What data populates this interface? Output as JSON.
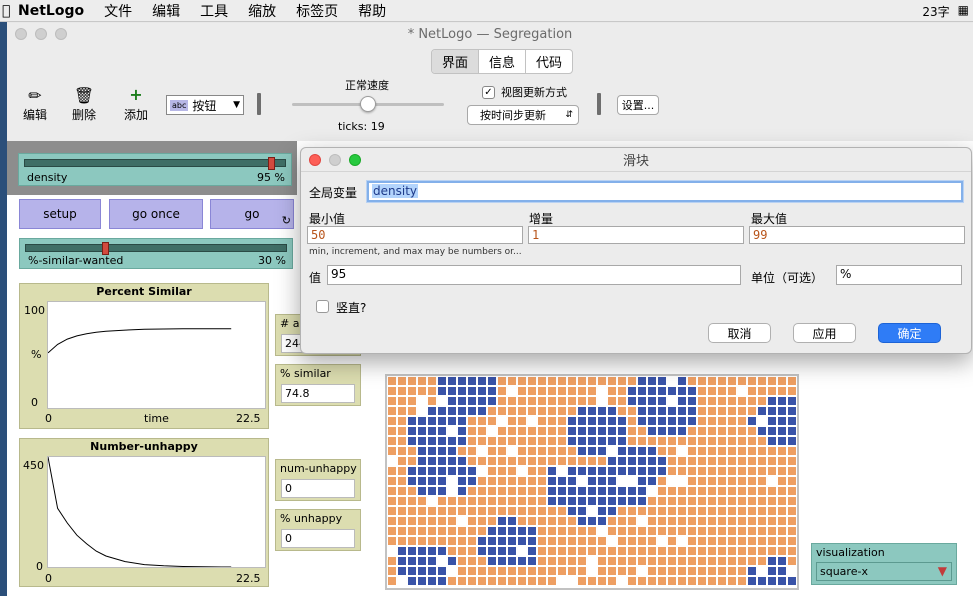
{
  "menubar": {
    "app": "NetLogo",
    "items": [
      "文件",
      "编辑",
      "工具",
      "缩放",
      "标签页",
      "帮助"
    ],
    "status": "23字"
  },
  "window": {
    "title": "* NetLogo — Segregation",
    "tabs": [
      "界面",
      "信息",
      "代码"
    ],
    "active_tab": "界面"
  },
  "toolbar": {
    "edit": "编辑",
    "delete": "删除",
    "add": "添加",
    "widget_type": "按钮",
    "speed_label": "正常速度",
    "ticks": "ticks: 19",
    "view_updates_label": "视图更新方式",
    "view_updates_checked": true,
    "update_mode": "按时间步更新",
    "settings": "设置..."
  },
  "interface": {
    "density_slider": {
      "name": "density",
      "value": "95 %",
      "fraction": 0.95
    },
    "buttons": {
      "setup": "setup",
      "go_once": "go once",
      "go": "go"
    },
    "similar_slider": {
      "name": "%-similar-wanted",
      "value": "30 %",
      "fraction": 0.3
    },
    "plot_similar": {
      "title": "Percent Similar",
      "ymax": "100",
      "ymin": "0",
      "xmin": "0",
      "xmax": "22.5",
      "xlabel": "time",
      "ylabel": "%"
    },
    "plot_unhappy": {
      "title": "Number-unhappy",
      "ymax": "450",
      "ymin": "0",
      "xmin": "0",
      "xmax": "22.5"
    },
    "monitors": {
      "agents": {
        "title": "# ag",
        "value": "244"
      },
      "similar": {
        "title": "% similar",
        "value": "74.8"
      },
      "num_unhappy": {
        "title": "num-unhappy",
        "value": "0"
      },
      "pct_unhappy": {
        "title": "% unhappy",
        "value": "0"
      }
    },
    "chooser": {
      "title": "visualization",
      "value": "square-x"
    },
    "colors": {
      "orange": "#ee9f63",
      "blue": "#3953a8",
      "empty": "#ffffff"
    }
  },
  "chart_data": [
    {
      "type": "line",
      "title": "Percent Similar",
      "xlabel": "time",
      "ylabel": "%",
      "xlim": [
        0,
        22.5
      ],
      "ylim": [
        0,
        100
      ],
      "x": [
        0,
        1,
        2,
        3,
        4,
        5,
        6,
        8,
        10,
        12,
        14,
        16,
        18,
        19
      ],
      "values": [
        52,
        60,
        65,
        68,
        70,
        71.5,
        72.5,
        73.5,
        74.2,
        74.5,
        74.7,
        74.8,
        74.8,
        74.8
      ]
    },
    {
      "type": "line",
      "title": "Number-unhappy",
      "xlabel": "",
      "ylabel": "",
      "xlim": [
        0,
        22.5
      ],
      "ylim": [
        0,
        450
      ],
      "x": [
        0,
        1,
        2,
        3,
        4,
        5,
        6,
        8,
        10,
        12,
        14,
        16,
        18,
        19
      ],
      "values": [
        450,
        240,
        180,
        130,
        95,
        65,
        45,
        22,
        10,
        5,
        2,
        1,
        0,
        0
      ]
    }
  ],
  "dialog": {
    "title": "滑块",
    "global_label": "全局变量",
    "global_value": "density",
    "min_label": "最小值",
    "min_value": "50",
    "inc_label": "增量",
    "inc_value": "1",
    "max_label": "最大值",
    "max_value": "99",
    "hint": "min, increment, and max may be numbers or...",
    "value_label": "值",
    "value": "95",
    "units_label": "单位（可选）",
    "units_value": "%",
    "vertical_label": "竖直?",
    "cancel": "取消",
    "apply": "应用",
    "ok": "确定"
  }
}
